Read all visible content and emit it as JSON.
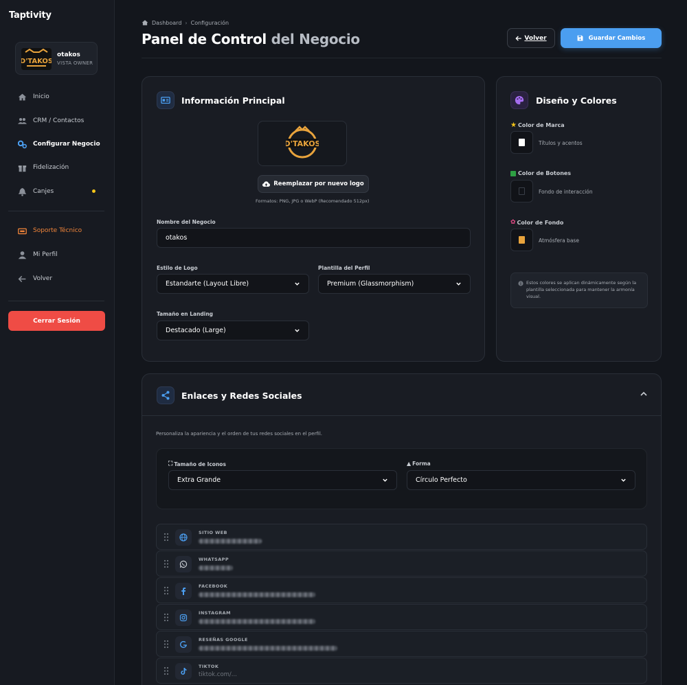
{
  "sidebar": {
    "brand": "Taptivity",
    "business": {
      "name": "otakos",
      "role": "VISTA OWNER",
      "logo_text": "D'TAKOS"
    },
    "items": [
      {
        "label": "Inicio",
        "icon": "home-icon"
      },
      {
        "label": "CRM / Contactos",
        "icon": "users-icon"
      },
      {
        "label": "Configurar Negocio",
        "icon": "gears-icon"
      },
      {
        "label": "Fidelización",
        "icon": "gift-icon"
      },
      {
        "label": "Canjes",
        "icon": "bell-icon"
      }
    ],
    "secondary": [
      {
        "label": "Soporte Técnico",
        "icon": "ticket-icon"
      },
      {
        "label": "Mi Perfil",
        "icon": "user-icon"
      },
      {
        "label": "Volver",
        "icon": "arrow-left-icon"
      }
    ],
    "logout": "Cerrar Sesión",
    "accent": "#f2853a"
  },
  "header": {
    "breadcrumb": [
      "Dashboard",
      "Configuración"
    ],
    "title_main": "Panel de Control",
    "title_muted": "del Negocio",
    "back_label": "Volver",
    "save_label": "Guardar Cambios"
  },
  "info": {
    "title": "Información Principal",
    "logo_text": "D'TAKOS",
    "replace_logo": "Reemplazar por nuevo logo",
    "formats_hint": "Formatos: PNG, JPG o WebP (Recomendado 512px)",
    "name_label": "Nombre del Negocio",
    "name_value": "otakos",
    "logo_style_label": "Estilo de Logo",
    "logo_style_value": "Estandarte (Layout Libre)",
    "template_label": "Plantilla del Perfil",
    "template_value": "Premium (Glassmorphism)",
    "size_label": "Tamaño en Landing",
    "size_value": "Destacado (Large)"
  },
  "design": {
    "title": "Diseño y Colores",
    "colors": [
      {
        "label": "Color de Marca",
        "desc": "Títulos y acentos",
        "value": "#ffffff",
        "icon": "star-icon"
      },
      {
        "label": "Color de Botones",
        "desc": "Fondo de interacción",
        "value": "#111318",
        "icon": "square-icon"
      },
      {
        "label": "Color de Fondo",
        "desc": "Atmósfera base",
        "value": "#e8a33c",
        "icon": "palette-icon"
      }
    ],
    "info": "Estos colores se aplican dinámicamente según la plantilla seleccionada para mantener la armonía visual."
  },
  "social": {
    "title": "Enlaces y Redes Sociales",
    "desc": "Personaliza la apariencia y el orden de tus redes sociales en el perfil.",
    "icon_size_label": "Tamaño de Iconos",
    "icon_size_value": "Extra Grande",
    "shape_label": "Forma",
    "shape_value": "Círculo Perfecto",
    "links": [
      {
        "label": "SITIO WEB",
        "icon": "globe-icon",
        "value": ""
      },
      {
        "label": "WHATSAPP",
        "icon": "whatsapp-icon",
        "value": ""
      },
      {
        "label": "FACEBOOK",
        "icon": "facebook-icon",
        "value": ""
      },
      {
        "label": "INSTAGRAM",
        "icon": "instagram-icon",
        "value": ""
      },
      {
        "label": "RESEÑAS GOOGLE",
        "icon": "google-icon",
        "value": ""
      },
      {
        "label": "TIKTOK",
        "icon": "tiktok-icon",
        "value": "tiktok.com/..."
      }
    ]
  }
}
